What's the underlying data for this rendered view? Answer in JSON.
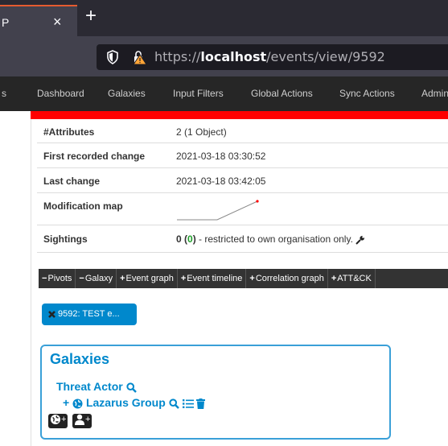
{
  "browser": {
    "tab_title": "P",
    "close_glyph": "×",
    "new_tab_glyph": "+",
    "url_prefix": "https://",
    "url_host": "localhost",
    "url_path": "/events/view/9592"
  },
  "nav": {
    "items": [
      "s",
      "Dashboard",
      "Galaxies",
      "Input Filters",
      "Global Actions",
      "Sync Actions",
      "Admin"
    ]
  },
  "event": {
    "rows": [
      {
        "label": "#Attributes",
        "value": "2 (1 Object)"
      },
      {
        "label": "First recorded change",
        "value": "2021-03-18 03:30:52"
      },
      {
        "label": "Last change",
        "value": "2021-03-18 03:42:05"
      },
      {
        "label": "Modification map",
        "value": ""
      },
      {
        "label": "Sightings",
        "value_prefix": "0 (",
        "value_count": "0",
        "value_suffix": ") - restricted to own organisation only."
      }
    ]
  },
  "toolbar": {
    "buttons": [
      {
        "sym": "−",
        "label": "Pivots"
      },
      {
        "sym": "−",
        "label": "Galaxy"
      },
      {
        "sym": "+",
        "label": "Event graph"
      },
      {
        "sym": "+",
        "label": "Event timeline"
      },
      {
        "sym": "+",
        "label": "Correlation graph"
      },
      {
        "sym": "+",
        "label": "ATT&CK"
      }
    ]
  },
  "pivot_chip": {
    "label": "9592: TEST e..."
  },
  "galaxies": {
    "title": "Galaxies",
    "category": "Threat Actor",
    "item_prefix": "+",
    "item": "Lazarus Group",
    "add_buttons": [
      "+",
      "+"
    ]
  },
  "colors": {
    "accent": "#0088cc",
    "nav_bg": "#262626",
    "threat_bar": "#ff0000",
    "sightings_count": "#1f9d2a"
  },
  "icons": [
    "shield-icon",
    "lock-warning-icon",
    "wrench-icon",
    "close-icon",
    "search-icon",
    "globe-icon",
    "list-icon",
    "trash-icon",
    "user-icon"
  ]
}
